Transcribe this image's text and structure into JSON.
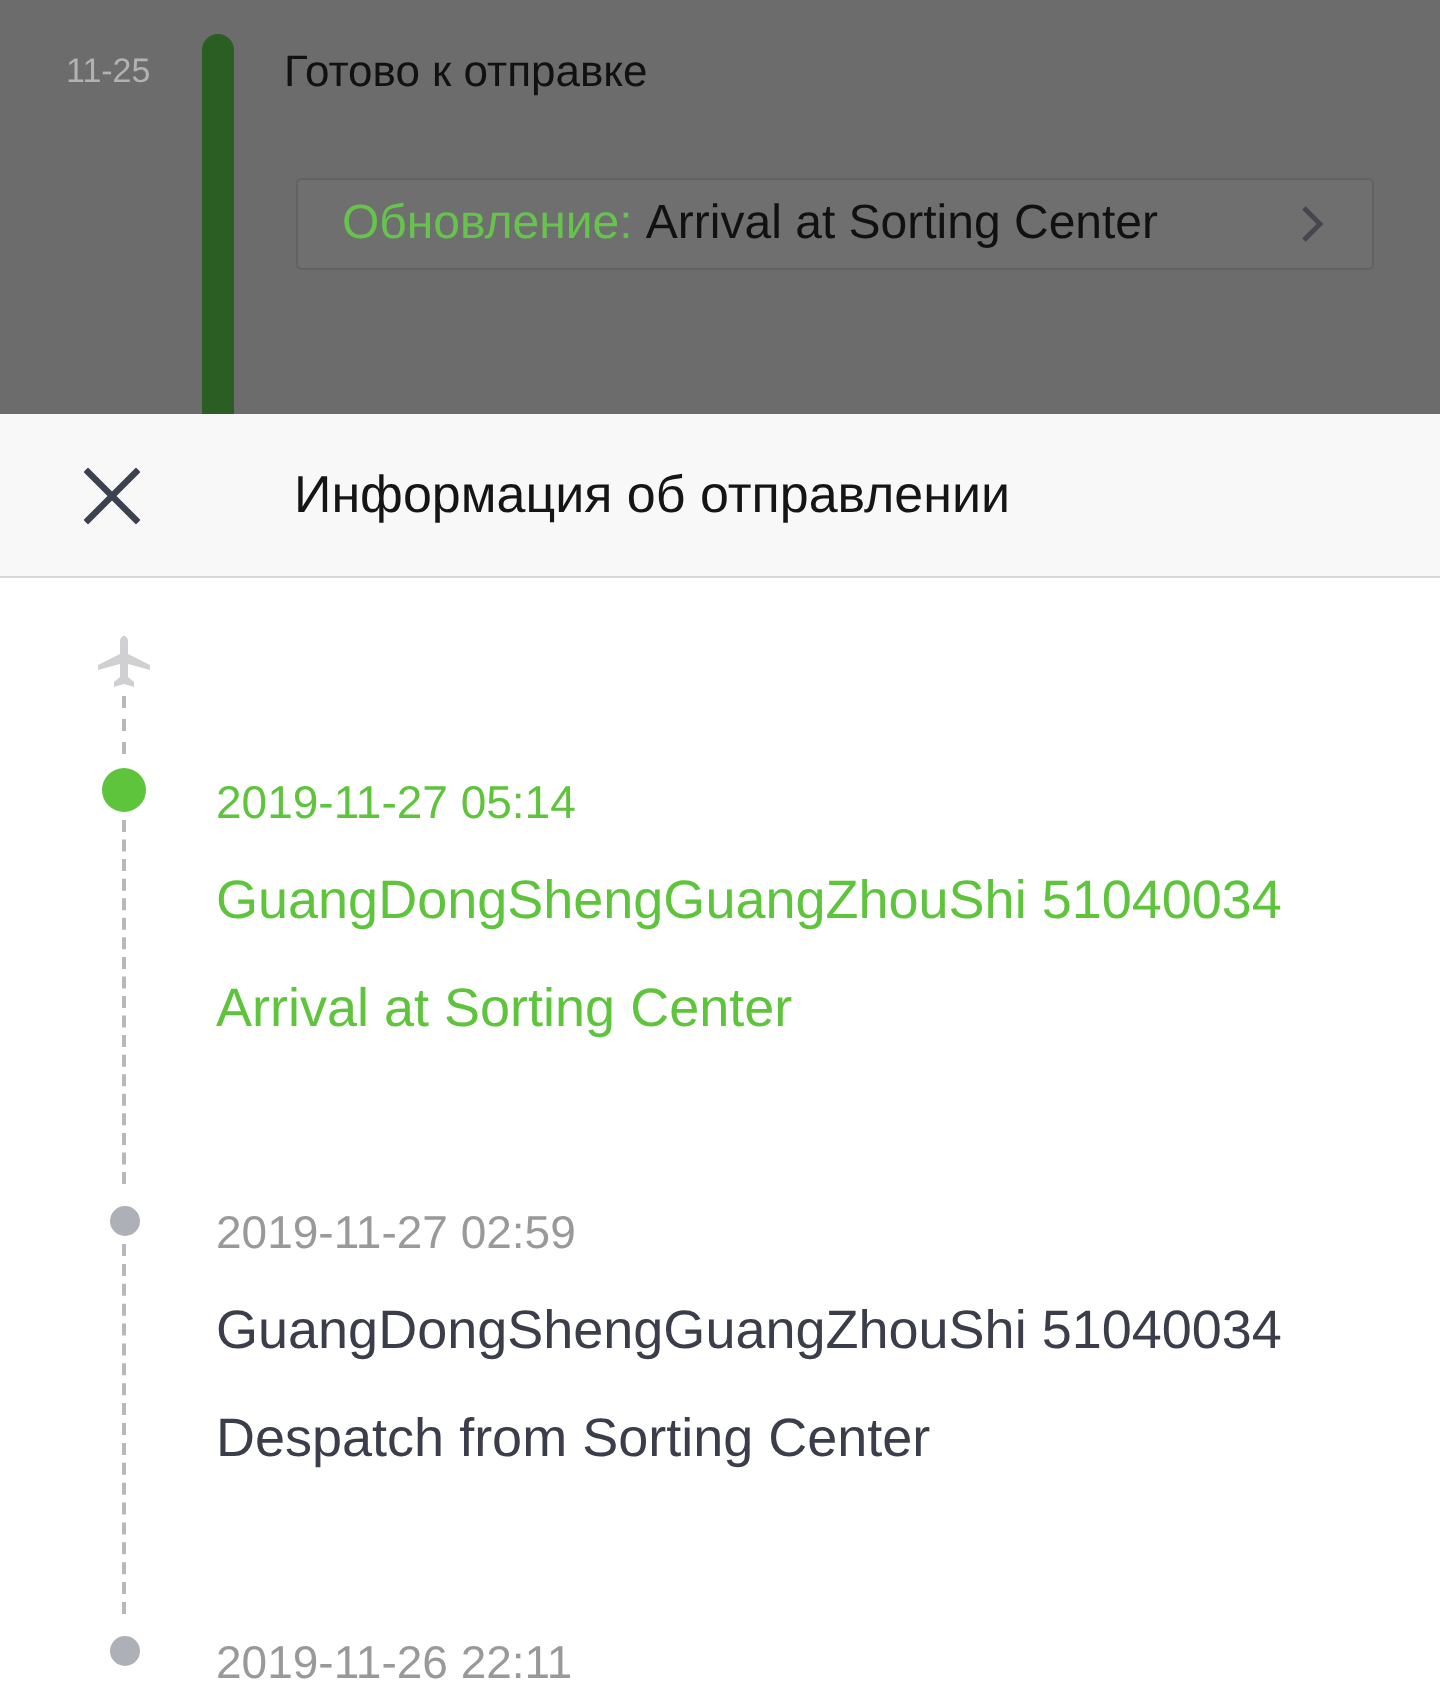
{
  "background_page": {
    "date": "11-25",
    "status": "Готово к отправке",
    "update": {
      "label": "Обновление:",
      "text": "Arrival at Sorting Center"
    }
  },
  "sheet": {
    "title": "Информация об отправлении"
  },
  "events": [
    {
      "time": "2019-11-27 05:14",
      "location": "GuangDongShengGuangZhouShi 51040034",
      "description": "Arrival at Sorting Center",
      "current": true
    },
    {
      "time": "2019-11-27 02:59",
      "location": "GuangDongShengGuangZhouShi 51040034",
      "description": "Despatch from Sorting Center",
      "current": false
    },
    {
      "time": "2019-11-26 22:11",
      "current": false
    }
  ]
}
